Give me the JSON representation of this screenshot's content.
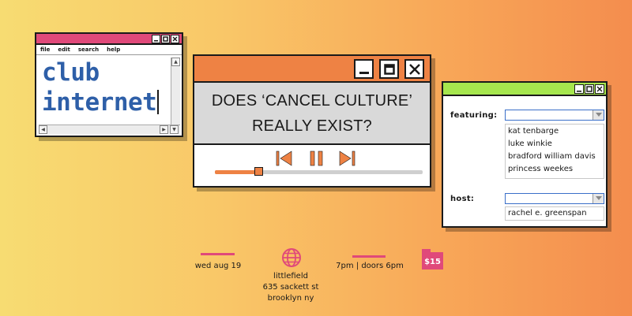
{
  "window_club": {
    "menu": [
      "file",
      "edit",
      "search",
      "help"
    ],
    "line1": "club",
    "line2": "internet"
  },
  "window_player": {
    "question_line1": "DOES ‘CANCEL CULTURE’",
    "question_line2": "REALLY EXIST?",
    "progress": 0.21
  },
  "window_people": {
    "featuring_label": "featuring:",
    "featuring": [
      "kat tenbarge",
      "luke winkie",
      "bradford william davis",
      "princess weekes"
    ],
    "host_label": "host:",
    "host": "rachel e. greenspan"
  },
  "event": {
    "date": "wed aug 19",
    "venue": "littlefield",
    "address": "635 sackett st",
    "city": "brooklyn ny",
    "time": "7pm | doors 6pm",
    "price": "$15"
  },
  "colors": {
    "pink": "#e0497a",
    "orange": "#ee8244",
    "green": "#a6e64e",
    "blue_text": "#2e5fa8"
  }
}
